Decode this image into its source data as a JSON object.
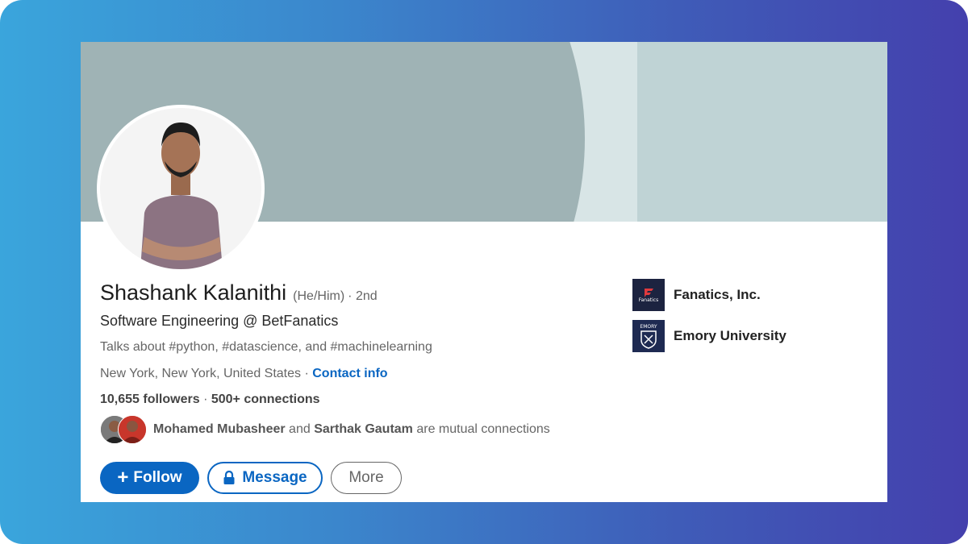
{
  "profile": {
    "name": "Shashank Kalanithi",
    "pronouns": "(He/Him)",
    "degree": "· 2nd",
    "headline": "Software Engineering @ BetFanatics",
    "talks_about": "Talks about #python, #datascience, and #machinelearning",
    "location": "New York, New York, United States",
    "location_separator": " · ",
    "contact_info": "Contact info",
    "followers": "10,655 followers",
    "connections_sep": " · ",
    "connections": "500+ connections"
  },
  "mutual": {
    "name1": "Mohamed Mubasheer",
    "conj": " and ",
    "name2": "Sarthak Gautam",
    "suffix": " are mutual connections"
  },
  "actions": {
    "follow": "Follow",
    "message": "Message",
    "more": "More"
  },
  "organizations": [
    {
      "name": "Fanatics, Inc.",
      "logo_text": "Fanatics",
      "icon": "fanatics-logo"
    },
    {
      "name": "Emory University",
      "logo_text": "EMORY",
      "icon": "emory-logo"
    }
  ],
  "colors": {
    "accent": "#0a66c2",
    "banner": "#bfd3d5",
    "banner_dark": "#9fb3b5",
    "frame_left": "#3aa5dc",
    "frame_right": "#4440ad"
  }
}
